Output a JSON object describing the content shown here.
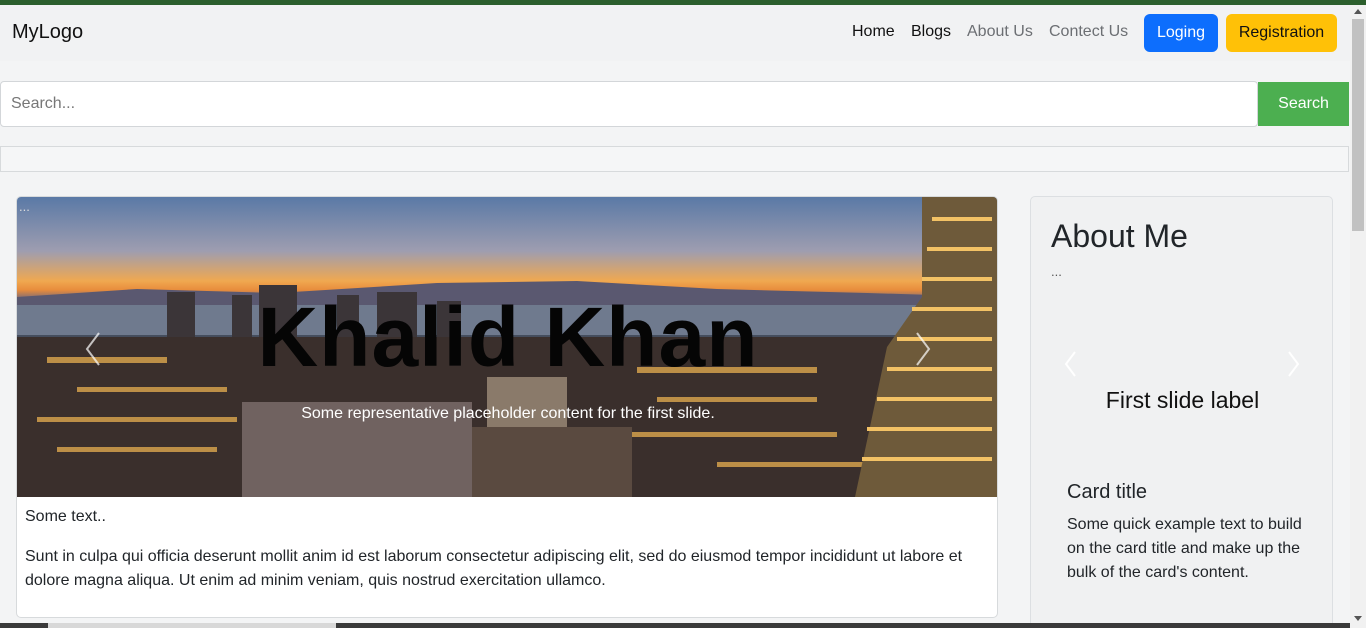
{
  "navbar": {
    "brand": "MyLogo",
    "links": [
      {
        "label": "Home"
      },
      {
        "label": "Blogs"
      },
      {
        "label": "About Us"
      },
      {
        "label": "Contect Us"
      }
    ],
    "login_label": "Loging",
    "register_label": "Registration"
  },
  "search": {
    "placeholder": "Search...",
    "button_label": "Search"
  },
  "main": {
    "image_alt": "...",
    "hero_title": "Khalid Khan",
    "hero_caption": "Some representative placeholder content for the first slide.",
    "short_text": "Some text..",
    "paragraph": "Sunt in culpa qui officia deserunt mollit anim id est laborum consectetur adipiscing elit, sed do eiusmod tempor incididunt ut labore et dolore magna aliqua. Ut enim ad minim veniam, quis nostrud exercitation ullamco."
  },
  "sidebar": {
    "title": "About Me",
    "image_alt": "...",
    "slide_label": "First slide label",
    "card_title": "Card title",
    "card_text": "Some quick example text to build on the card title and make up the bulk of the card's content."
  },
  "colors": {
    "login": "#0d6efd",
    "register": "#ffc107",
    "search_button": "#4caf50",
    "top_stripe": "#2c5f2d"
  }
}
